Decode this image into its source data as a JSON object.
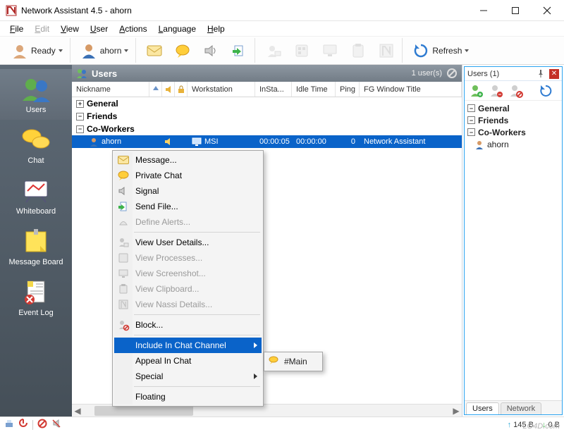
{
  "window": {
    "title": "Network Assistant 4.5 - ahorn"
  },
  "menu": {
    "file": "File",
    "edit": "Edit",
    "view": "View",
    "user": "User",
    "actions": "Actions",
    "language": "Language",
    "help": "Help"
  },
  "toolbar": {
    "status_label": "Ready",
    "user_label": "ahorn",
    "refresh_label": "Refresh"
  },
  "nav": {
    "users": "Users",
    "chat": "Chat",
    "whiteboard": "Whiteboard",
    "message_board": "Message Board",
    "event_log": "Event Log"
  },
  "panel": {
    "title": "Users",
    "count": "1 user(s)"
  },
  "columns": {
    "nickname": "Nickname",
    "workstation": "Workstation",
    "insta": "InSta...",
    "idle": "Idle Time",
    "ping": "Ping",
    "fg": "FG Window Title"
  },
  "groups": {
    "general": "General",
    "friends": "Friends",
    "coworkers": "Co-Workers"
  },
  "user_row": {
    "nickname": "ahorn",
    "workstation": "MSI",
    "insta": "00:00:05",
    "idle": "00:00:00",
    "ping": "0",
    "fg": "Network Assistant"
  },
  "side_panel": {
    "title": "Users (1)",
    "tabs": {
      "users": "Users",
      "network": "Network"
    },
    "groups": {
      "general": "General",
      "friends": "Friends",
      "coworkers": "Co-Workers"
    },
    "user": "ahorn"
  },
  "context_menu": {
    "message": "Message...",
    "private_chat": "Private Chat",
    "signal": "Signal",
    "send_file": "Send File...",
    "define_alerts": "Define Alerts...",
    "view_user_details": "View User Details...",
    "view_processes": "View Processes...",
    "view_screenshot": "View Screenshot...",
    "view_clipboard": "View Clipboard...",
    "view_nassi": "View Nassi Details...",
    "block": "Block...",
    "include_channel": "Include In Chat Channel",
    "appeal": "Appeal In Chat",
    "special": "Special",
    "floating": "Floating"
  },
  "submenu": {
    "main": "#Main"
  },
  "status": {
    "upload": "145 B",
    "download": "0 B"
  },
  "watermark": "LO4D.com"
}
